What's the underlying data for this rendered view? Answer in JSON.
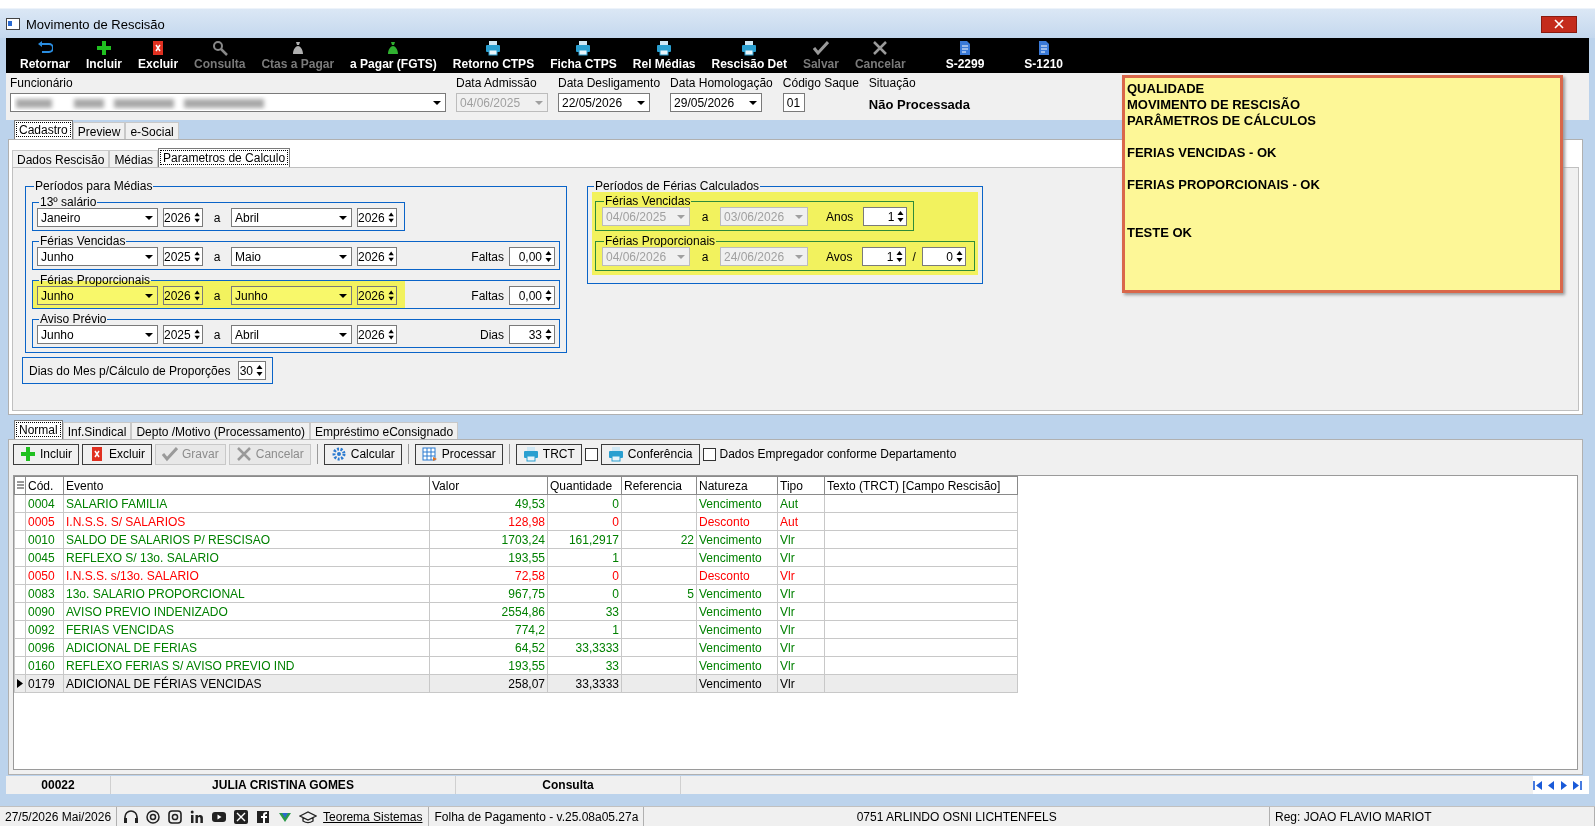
{
  "window": {
    "title": "Movimento de Rescisão"
  },
  "toolbar": [
    {
      "label": "Retornar",
      "kind": "return",
      "disabled": false
    },
    {
      "label": "Incluir",
      "kind": "plus",
      "disabled": false
    },
    {
      "label": "Excluir",
      "kind": "delete",
      "disabled": false
    },
    {
      "label": "Consulta",
      "kind": "search",
      "disabled": true
    },
    {
      "label": "Ctas a Pagar",
      "kind": "moneybag",
      "disabled": true
    },
    {
      "label": "a Pagar (FGTS)",
      "kind": "moneybag",
      "disabled": false
    },
    {
      "label": "Retorno CTPS",
      "kind": "printer",
      "disabled": false
    },
    {
      "label": "Ficha CTPS",
      "kind": "printer",
      "disabled": false
    },
    {
      "label": "Rel Médias",
      "kind": "printer",
      "disabled": false
    },
    {
      "label": "Rescisão Det",
      "kind": "printer",
      "disabled": false
    },
    {
      "label": "Salvar",
      "kind": "check",
      "disabled": true
    },
    {
      "label": "Cancelar",
      "kind": "cross",
      "disabled": true
    },
    {
      "label": "S-2299",
      "kind": "document",
      "disabled": false
    },
    {
      "label": "S-1210",
      "kind": "document",
      "disabled": false
    }
  ],
  "header": {
    "employee": {
      "label": "Funcionário"
    },
    "fields": [
      {
        "label": "Data Admissão",
        "value": "04/06/2025",
        "kind": "dropdown",
        "disabled": true
      },
      {
        "label": "Data Desligamento",
        "value": "22/05/2026",
        "kind": "dropdown",
        "disabled": false
      },
      {
        "label": "Data Homologação",
        "value": "29/05/2026",
        "kind": "dropdown",
        "disabled": false
      },
      {
        "label": "Código Saque",
        "value": "01",
        "kind": "input"
      },
      {
        "label": "Situação",
        "value": "Não Processada",
        "kind": "status"
      }
    ]
  },
  "main_tabs": [
    {
      "label": "Cadastro",
      "selected": true
    },
    {
      "label": "Preview",
      "selected": false
    },
    {
      "label": "e-Social",
      "selected": false
    }
  ],
  "sub_tabs": [
    {
      "label": "Dados Rescisão",
      "selected": false
    },
    {
      "label": "Médias",
      "selected": false
    },
    {
      "label": "Parametros de Calculo",
      "selected": true
    }
  ],
  "averages": {
    "title": "Períodos para Médias",
    "periods": [
      {
        "title": "13º salário",
        "from_month": "Janeiro",
        "from_year": "2026",
        "separator": "a",
        "to_month": "Abril",
        "to_year": "2026",
        "highlighted": false
      },
      {
        "title": "Férias Vencidas",
        "from_month": "Junho",
        "from_year": "2025",
        "separator": "a",
        "to_month": "Maio",
        "to_year": "2026",
        "extra_label": "Faltas",
        "extra_value": "0,00",
        "highlighted": false
      },
      {
        "title": "Férias Proporcionais",
        "from_month": "Junho",
        "from_year": "2026",
        "separator": "a",
        "to_month": "Junho",
        "to_year": "2026",
        "extra_label": "Faltas",
        "extra_value": "0,00",
        "highlighted": true
      },
      {
        "title": "Aviso Prévio",
        "from_month": "Junho",
        "from_year": "2025",
        "separator": "a",
        "to_month": "Abril",
        "to_year": "2026",
        "extra_label": "Dias",
        "extra_value": "33",
        "highlighted": false
      }
    ]
  },
  "days_of_month": {
    "label": "Dias do Mes p/Cálculo de Proporções",
    "value": "30"
  },
  "vacations": {
    "title": "Períodos de Férias Calculados",
    "highlighted": true,
    "periods": [
      {
        "title": "Férias Vencidas",
        "from": "04/06/2025",
        "separator": "a",
        "to": "03/06/2026",
        "count_label": "Anos",
        "count": "1"
      },
      {
        "title": "Férias Proporcionais",
        "from": "04/06/2026",
        "separator": "a",
        "to": "24/06/2026",
        "count_label": "Avos",
        "count": "1",
        "slash": "/",
        "count2": "0"
      }
    ]
  },
  "note": {
    "blocks": [
      [
        "QUALIDADE",
        "MOVIMENTO DE RESCISÃO",
        "PARÂMETROS DE CÁLCULOS"
      ],
      [
        "FERIAS VENCIDAS - OK"
      ],
      [
        "FERIAS PROPORCIONAIS - OK"
      ],
      [
        "TESTE OK"
      ]
    ]
  },
  "bottom_tabs": [
    {
      "label": "Normal",
      "selected": true
    },
    {
      "label": "Inf.Sindical",
      "selected": false
    },
    {
      "label": "Depto /Motivo (Processamento)",
      "selected": false
    },
    {
      "label": "Empréstimo eConsignado",
      "selected": false
    }
  ],
  "actions": [
    {
      "kind": "button",
      "label": "Incluir",
      "disabled": false
    },
    {
      "kind": "button",
      "label": "Excluir",
      "disabled": false
    },
    {
      "kind": "button",
      "label": "Gravar",
      "disabled": true
    },
    {
      "kind": "button",
      "label": "Cancelar",
      "disabled": true
    },
    {
      "kind": "separator"
    },
    {
      "kind": "button",
      "label": "Calcular",
      "disabled": false
    },
    {
      "kind": "separator"
    },
    {
      "kind": "button",
      "label": "Processar",
      "disabled": false
    },
    {
      "kind": "separator"
    },
    {
      "kind": "button",
      "label": "TRCT",
      "disabled": false
    },
    {
      "kind": "checkbox",
      "checked": false
    },
    {
      "kind": "button",
      "label": "Conferência",
      "disabled": false
    },
    {
      "kind": "checkbox",
      "label": "Dados Empregador conforme Departamento",
      "checked": false
    }
  ],
  "table": {
    "columns": [
      "Cód.",
      "Evento",
      "Valor",
      "Quantidade",
      "Referencia",
      "Natureza",
      "Tipo",
      "Texto (TRCT) [Campo Rescisão]"
    ],
    "rows": [
      {
        "cells": [
          "0004",
          "SALARIO FAMILIA",
          "49,53",
          "0",
          "",
          "Vencimento",
          "Aut",
          ""
        ],
        "color": "#008000",
        "selected": false
      },
      {
        "cells": [
          "0005",
          "I.N.S.S. S/ SALARIOS",
          "128,98",
          "0",
          "",
          "Desconto",
          "Aut",
          ""
        ],
        "color": "#ff0000",
        "selected": false
      },
      {
        "cells": [
          "0010",
          "SALDO DE SALARIOS P/ RESCISAO",
          "1703,24",
          "161,2917",
          "22",
          "Vencimento",
          "Vlr",
          ""
        ],
        "color": "#008000",
        "selected": false
      },
      {
        "cells": [
          "0045",
          "REFLEXO S/ 13o. SALARIO",
          "193,55",
          "1",
          "",
          "Vencimento",
          "Vlr",
          ""
        ],
        "color": "#008000",
        "selected": false
      },
      {
        "cells": [
          "0050",
          "I.N.S.S. s/13o. SALARIO",
          "72,58",
          "0",
          "",
          "Desconto",
          "Vlr",
          ""
        ],
        "color": "#ff0000",
        "selected": false
      },
      {
        "cells": [
          "0083",
          "13o. SALARIO PROPORCIONAL",
          "967,75",
          "0",
          "5",
          "Vencimento",
          "Vlr",
          ""
        ],
        "color": "#008000",
        "selected": false
      },
      {
        "cells": [
          "0090",
          "AVISO PREVIO INDENIZADO",
          "2554,86",
          "33",
          "",
          "Vencimento",
          "Vlr",
          ""
        ],
        "color": "#008000",
        "selected": false
      },
      {
        "cells": [
          "0092",
          "FERIAS VENCIDAS",
          "774,2",
          "1",
          "",
          "Vencimento",
          "Vlr",
          ""
        ],
        "color": "#008000",
        "selected": false
      },
      {
        "cells": [
          "0096",
          "ADICIONAL DE FERIAS",
          "64,52",
          "33,3333",
          "",
          "Vencimento",
          "Vlr",
          ""
        ],
        "color": "#008000",
        "selected": false
      },
      {
        "cells": [
          "0160",
          "REFLEXO FERIAS S/ AVISO PREVIO IND",
          "193,55",
          "33",
          "",
          "Vencimento",
          "Vlr",
          ""
        ],
        "color": "#008000",
        "selected": false
      },
      {
        "cells": [
          "0179",
          "ADICIONAL DE FÉRIAS VENCIDAS",
          "258,07",
          "33,3333",
          "",
          "Vencimento",
          "Vlr",
          ""
        ],
        "color": "#000000",
        "selected": true
      }
    ]
  },
  "status_bar": [
    "00022",
    "JULIA CRISTINA GOMES",
    "Consulta"
  ],
  "taskbar": {
    "date": "27/5/2026 Mai/2026",
    "link": "Teorema Sistemas",
    "version": "Folha de Pagamento - v.25.08a05.27a",
    "company": "0751 ARLINDO OSNI LICHTENFELS",
    "user": "Reg: JOAO FLAVIO MARIOT"
  }
}
